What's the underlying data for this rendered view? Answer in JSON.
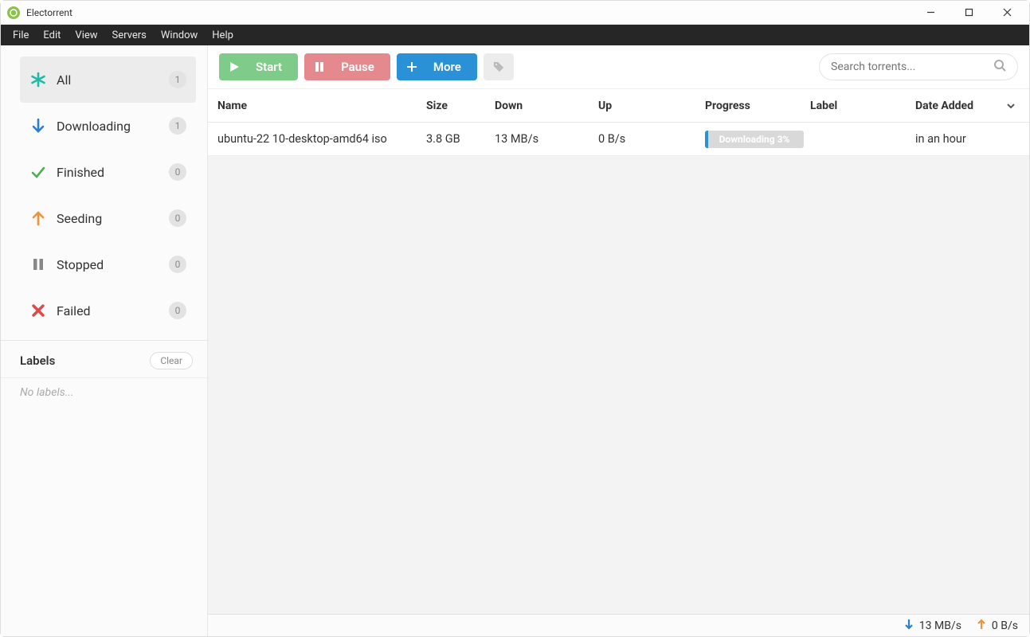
{
  "window": {
    "title": "Electorrent"
  },
  "menubar": [
    "File",
    "Edit",
    "View",
    "Servers",
    "Window",
    "Help"
  ],
  "sidebar": {
    "filters": [
      {
        "id": "all",
        "label": "All",
        "count": "1",
        "icon": "asterisk",
        "color": "#1fbba6",
        "active": true
      },
      {
        "id": "downloading",
        "label": "Downloading",
        "count": "1",
        "icon": "arrow-down",
        "color": "#2a7fd4",
        "active": false
      },
      {
        "id": "finished",
        "label": "Finished",
        "count": "0",
        "icon": "check",
        "color": "#4caf50",
        "active": false
      },
      {
        "id": "seeding",
        "label": "Seeding",
        "count": "0",
        "icon": "arrow-up",
        "color": "#f0933b",
        "active": false
      },
      {
        "id": "stopped",
        "label": "Stopped",
        "count": "0",
        "icon": "pause",
        "color": "#888888",
        "active": false
      },
      {
        "id": "failed",
        "label": "Failed",
        "count": "0",
        "icon": "cross",
        "color": "#e04848",
        "active": false
      }
    ],
    "labels_title": "Labels",
    "labels_clear": "Clear",
    "labels_empty": "No labels..."
  },
  "toolbar": {
    "start": "Start",
    "pause": "Pause",
    "more": "More",
    "search_placeholder": "Search torrents..."
  },
  "columns": {
    "name": "Name",
    "size": "Size",
    "down": "Down",
    "up": "Up",
    "progress": "Progress",
    "label": "Label",
    "date": "Date Added"
  },
  "rows": [
    {
      "name": "ubuntu-22 10-desktop-amd64 iso",
      "size": "3.8 GB",
      "down": "13 MB/s",
      "up": "0 B/s",
      "progress_pct": 3,
      "progress_text": "Downloading 3%",
      "label": "",
      "date": "in an hour"
    }
  ],
  "status": {
    "down": "13 MB/s",
    "up": "0 B/s"
  }
}
